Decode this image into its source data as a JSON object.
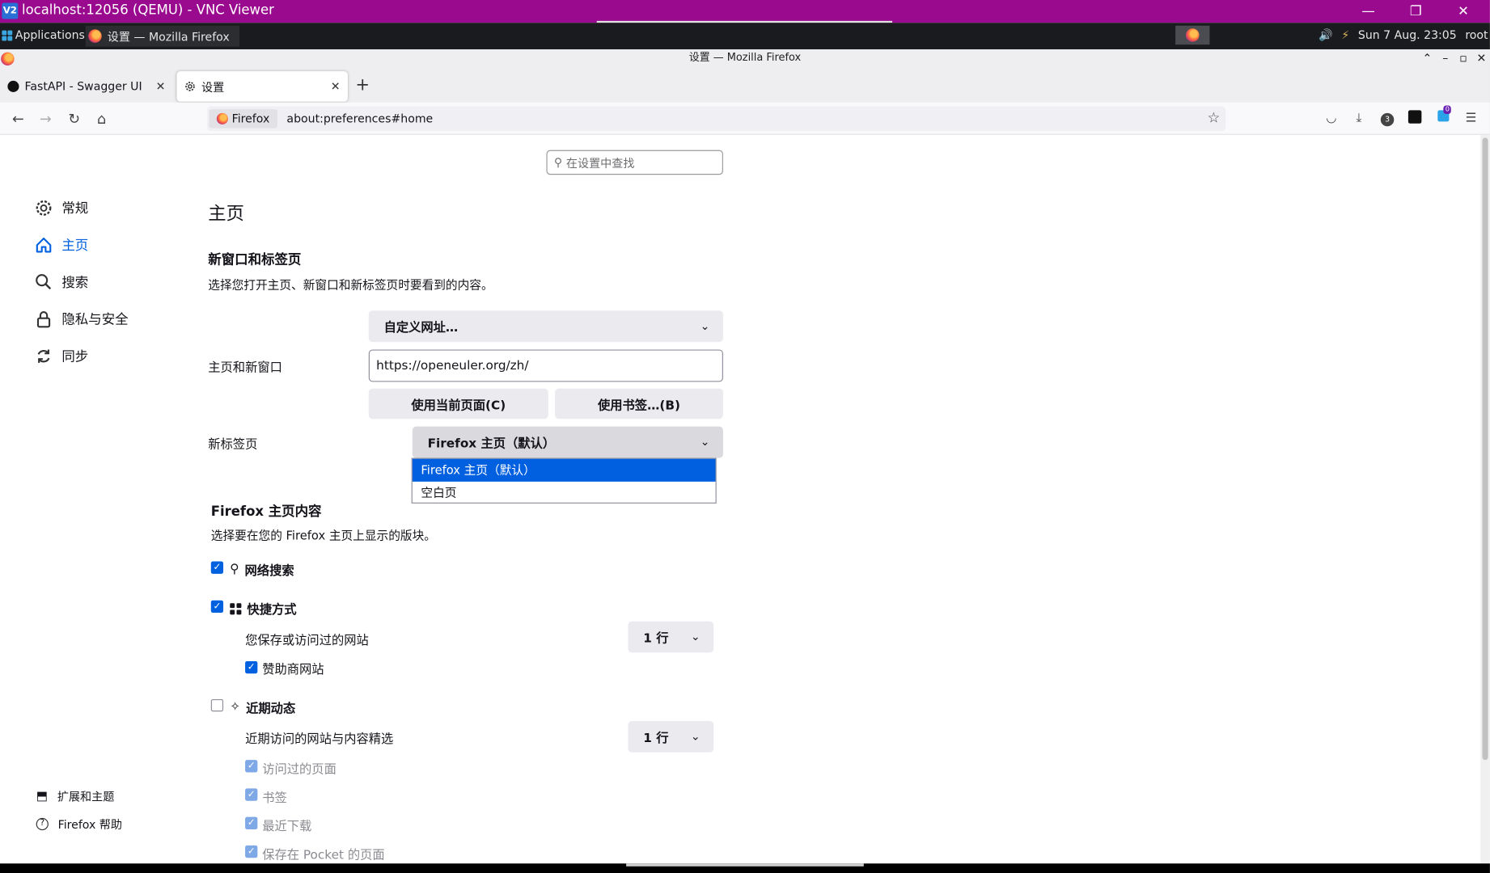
{
  "vnc": {
    "logo": "V2",
    "title": "localhost:12056 (QEMU) - VNC Viewer",
    "minimize": "—",
    "restore": "❐",
    "close": "✕"
  },
  "panel": {
    "applications": "Applications",
    "task_title": "设置 — Mozilla Firefox",
    "clock": "Sun  7 Aug. 23:05",
    "user": "root"
  },
  "firefox": {
    "window_title": "设置 — Mozilla Firefox",
    "tabs": [
      {
        "label": "FastAPI - Swagger UI"
      },
      {
        "label": "设置"
      }
    ],
    "identity_label": "Firefox",
    "url": "about:preferences#home",
    "badge_count": "3",
    "notify_count": "0"
  },
  "prefs": {
    "search_placeholder": "在设置中查找",
    "categories": [
      {
        "label": "常规"
      },
      {
        "label": "主页"
      },
      {
        "label": "搜索"
      },
      {
        "label": "隐私与安全"
      },
      {
        "label": "同步"
      }
    ],
    "footer": {
      "extensions": "扩展和主题",
      "help": "Firefox 帮助"
    },
    "page_title": "主页",
    "new_windows": {
      "heading": "新窗口和标签页",
      "description": "选择您打开主页、新窗口和新标签页时要看到的内容。",
      "homepage_select": "自定义网址…",
      "homepage_label": "主页和新窗口",
      "homepage_url": "https://openeuler.org/zh/",
      "use_current": "使用当前页面(C)",
      "use_bookmark": "使用书签…(B)",
      "newtab_label": "新标签页",
      "newtab_select": "Firefox 主页（默认）",
      "newtab_options": [
        "Firefox 主页（默认）",
        "空白页"
      ]
    },
    "home_content": {
      "heading": "Firefox 主页内容",
      "description": "选择要在您的 Firefox 主页上显示的版块。",
      "web_search": "网络搜索",
      "shortcuts": "快捷方式",
      "shortcuts_sub": "您保存或访问过的网站",
      "shortcuts_rows": "1 行",
      "sponsored": "赞助商网站",
      "recent": "近期动态",
      "recent_sub": "近期访问的网站与内容精选",
      "recent_rows": "1 行",
      "visited": "访问过的页面",
      "bookmarks": "书签",
      "downloads": "最近下载",
      "pocket": "保存在 Pocket 的页面"
    }
  }
}
